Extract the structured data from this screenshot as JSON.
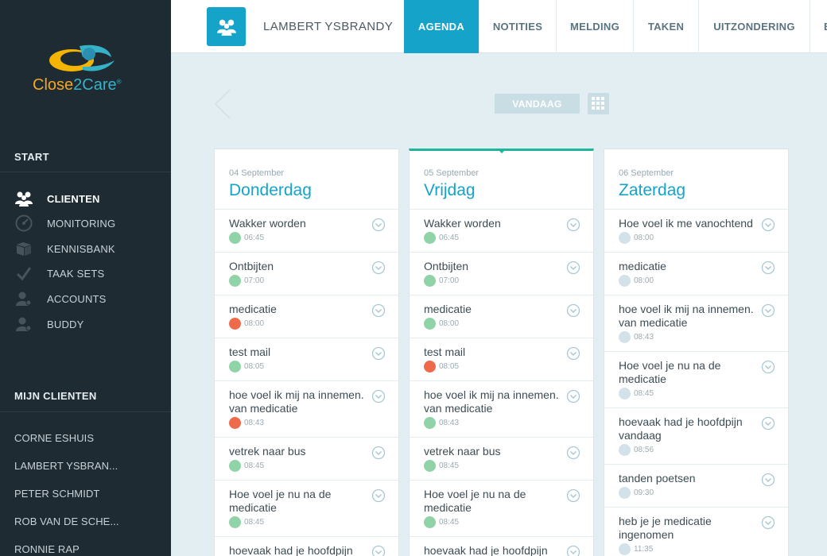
{
  "app": {
    "brand_part1": "Close",
    "brand_part2": "2Care",
    "brand_mark": "®"
  },
  "colors": {
    "accent": "#16a3c9",
    "sidebar": "#1f2b33",
    "green": "#8fd3a6",
    "red": "#ef6a4a",
    "grey": "#d3e2e8",
    "current_day": "#1fb59a"
  },
  "sidebar": {
    "start_title": "START",
    "nav": [
      {
        "label": "CLIENTEN",
        "icon": "users-icon",
        "active": true
      },
      {
        "label": "MONITORING",
        "icon": "gauge-icon",
        "active": false
      },
      {
        "label": "KENNISBANK",
        "icon": "books-icon",
        "active": false
      },
      {
        "label": "TAAK SETS",
        "icon": "check-icon",
        "active": false
      },
      {
        "label": "ACCOUNTS",
        "icon": "user-key-icon",
        "active": false
      },
      {
        "label": "BUDDY",
        "icon": "user-key-icon",
        "active": false
      }
    ],
    "my_clients_title": "MIJN CLIENTEN",
    "clients": [
      "CORNE ESHUIS",
      "LAMBERT YSBRAN...",
      "PETER SCHMIDT",
      "ROB VAN DE SCHE...",
      "RONNIE RAP"
    ]
  },
  "header": {
    "client_name": "LAMBERT YSBRANDY",
    "tabs": [
      "AGENDA",
      "NOTITIES",
      "MELDING",
      "TAKEN",
      "UITZONDERING",
      "B"
    ]
  },
  "controls": {
    "today_label": "VANDAAG"
  },
  "days": [
    {
      "date": "04 September",
      "name": "Donderdag",
      "events": [
        {
          "title": "Wakker worden",
          "time": "06:45",
          "status": "green"
        },
        {
          "title": "Ontbijten",
          "time": "07:00",
          "status": "green"
        },
        {
          "title": "medicatie",
          "time": "08:00",
          "status": "red"
        },
        {
          "title": "test mail",
          "time": "08:05",
          "status": "green"
        },
        {
          "title": "hoe voel ik mij na innemen. van medicatie",
          "time": "08:43",
          "status": "red"
        },
        {
          "title": "vetrek naar bus",
          "time": "08:45",
          "status": "green"
        },
        {
          "title": "Hoe voel je nu na de medicatie",
          "time": "08:45",
          "status": "green"
        },
        {
          "title": "hoevaak had je hoofdpijn",
          "time": "",
          "status": "green"
        }
      ]
    },
    {
      "date": "05 September",
      "name": "Vrijdag",
      "events": [
        {
          "title": "Wakker worden",
          "time": "06:45",
          "status": "green"
        },
        {
          "title": "Ontbijten",
          "time": "07:00",
          "status": "green"
        },
        {
          "title": "medicatie",
          "time": "08:00",
          "status": "green"
        },
        {
          "title": "test mail",
          "time": "08:05",
          "status": "red"
        },
        {
          "title": "hoe voel ik mij na innemen. van medicatie",
          "time": "08:43",
          "status": "green"
        },
        {
          "title": "vetrek naar bus",
          "time": "08:45",
          "status": "green"
        },
        {
          "title": "Hoe voel je nu na de medicatie",
          "time": "08:45",
          "status": "green"
        },
        {
          "title": "hoevaak had je hoofdpijn",
          "time": "",
          "status": "green"
        }
      ]
    },
    {
      "date": "06 September",
      "name": "Zaterdag",
      "events": [
        {
          "title": "Hoe voel ik me vanochtend",
          "time": "08:00",
          "status": "grey"
        },
        {
          "title": "medicatie",
          "time": "08:00",
          "status": "grey"
        },
        {
          "title": "hoe voel ik mij na innemen. van medicatie",
          "time": "08:43",
          "status": "grey"
        },
        {
          "title": "Hoe voel je nu na de medicatie",
          "time": "08:45",
          "status": "grey"
        },
        {
          "title": "hoevaak had je hoofdpijn vandaag",
          "time": "08:56",
          "status": "grey"
        },
        {
          "title": "tanden poetsen",
          "time": "09:30",
          "status": "grey"
        },
        {
          "title": "heb je je medicatie ingenomen",
          "time": "11:35",
          "status": "grey"
        }
      ]
    }
  ]
}
